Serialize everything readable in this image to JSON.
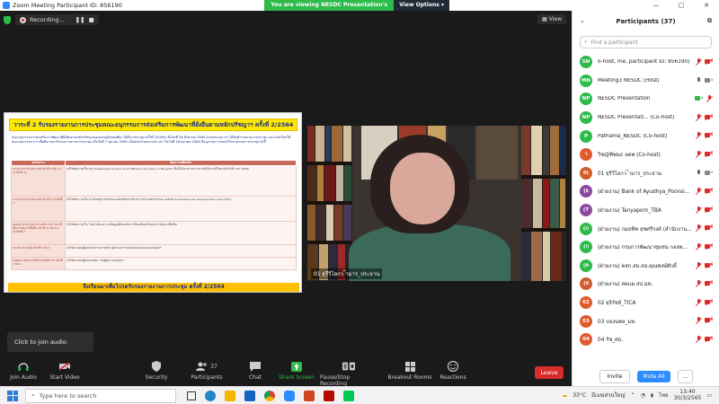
{
  "window": {
    "title": "Zoom Meeting Participant ID: 856190",
    "share_banner": "You are viewing NESDC Presentation's screen",
    "view_options": "View Options"
  },
  "meeting": {
    "recording_label": "Recording...",
    "view_label": "View",
    "video_name": "01 ฐุรีวิไลกว ๊ามาร_ประธาน"
  },
  "slide": {
    "title": "วาระที่ 2 รับรองรายงานการประชุมคณะอนุกรรมการส่งเสริมการพัฒนาที่ยั่งยืนตามหลักปรัชญาฯ ครั้งที่ 2/2564",
    "paragraph": "คณะอนุกรรมการส่งเสริมการพัฒนาที่ยั่งยืนตามหลักปรัชญาของเศรษฐกิจพอเพียง ได้มีการประชุม ครั้งที่ 2/2564 เมื่อวันที่ 26 สิงหาคม 2564 ฝ่ายเลขานุการฯ ได้จัดทำรายงานการประชุม และแจ้งเวียนให้คณะอนุกรรมการฯ เพื่อพิจารณารับรองรายงานการประชุม เมื่อวันที่ 7 ตุลาคม 2564 เมื่อครบกำหนดระยะเวลา ในวันที่ 18 ตุลาคม 2564 มีอนุกรรมการขอแก้ไขรายงานการประชุม ดังนี้",
    "col_headers": [
      "หน่วยงาน",
      "ข้อความเพิ่มเติม"
    ],
    "rows": [
      {
        "label": "กระทรวงการต่างประเทศ หน้าที่ 8 ข้อ 2.1 บรรทัดที่ 11",
        "desc": "แก้ไขข้อความเป็น 'the Sustainable Tourism and Sufficiency Economy in Mongolia' ซึ่งเป็นโครงการความร่วมมือไตรภาคีไทย มองโกเลีย และ UNDP"
      },
      {
        "label": "กระทรวงการต่างประเทศ หน้าที่ 9 บรรทัดที่ 4",
        "desc": "แก้ไขข้อความเป็น 'ครอบคลุมการดำเนินงานตามพันธกรณีระหว่างประเทศตามกรอบ ASEAN Southeast Asian Development Goal (SDG)'"
      },
      {
        "label": "ศูนย์ประสานงานความร่วมมือ ระหว่างภาคีเพื่อการพัฒนาที่ยั่งยืน หน้าที่ 11 ข้อ 2.5 บรรทัดที่ 3",
        "desc": "แก้ไขข้อความเป็น 'ในการพัฒนาระบบข้อมูลเพื่อรองรับการขับเคลื่อนเป้าหมายการพัฒนาที่ยั่งยืน'"
      },
      {
        "label": "กระทรวงการคลัง หน้าที่ 5 ข้อ 1",
        "desc": "แก้ไขคำแหน่งผู้แทนกระทรวงการคลัง 'ผู้อำนวยการกองนโยบายและแผนงานคลังฯ'"
      },
      {
        "label": "กองทุนการพัฒนาเครือข่ายทรัพยากร หน้าที่ 5 ข้อ 2",
        "desc": "แก้ไขคำแหน่งผู้แทนกองทุน 'รองผู้จัดการกองทุนฯ'"
      }
    ],
    "footer": "จึงเรียนมาเพื่อโปรดรับรองรายงานการประชุม ครั้งที่ 2/2564"
  },
  "tooltip": "Click to join audio",
  "toolbar": {
    "join_audio": "Join Audio",
    "start_video": "Start Video",
    "security": "Security",
    "participants": "Participants",
    "participants_count": "37",
    "chat": "Chat",
    "share_screen": "Share Screen",
    "pause_recording": "Pause/Stop Recording",
    "breakout_rooms": "Breakout Rooms",
    "reactions": "Reactions",
    "leave": "Leave"
  },
  "panel": {
    "title": "Participants (37)",
    "search_placeholder": "Find a participant",
    "invite": "Invite",
    "mute_all": "Mute All",
    "more": "...",
    "participants": [
      {
        "initials": "SN",
        "color": "#2dbb4a",
        "name": "o-host, me, participant ID: 856190)",
        "mic": "muted",
        "cam": "off"
      },
      {
        "initials": "MN",
        "color": "#2dbb4a",
        "name": "Meeting3 NESDC (Host)",
        "mic": "normal",
        "cam": "normal"
      },
      {
        "initials": "NP",
        "color": "#2dbb4a",
        "name": "NESDC Presentation",
        "mic": "muted",
        "cam": "on"
      },
      {
        "initials": "NP",
        "color": "#2dbb4a",
        "name": "NESDC Presentati... (Co-host)",
        "mic": "muted",
        "cam": "off"
      },
      {
        "initials": "P",
        "color": "#2dbb4a",
        "name": "Pathama_NESDC (Co-host)",
        "mic": "muted",
        "cam": "off"
      },
      {
        "initials": "ว",
        "color": "#e05a2b",
        "name": "วิชญ์ฑิพนธ ลดพ (Co-host)",
        "mic": "muted",
        "cam": "off"
      },
      {
        "initials": "0(",
        "color": "#d45b2b",
        "name": "01 ฐุรีวิไลกว ๊ามาร_ประธาน",
        "mic": "normal",
        "cam": "normal"
      },
      {
        "initials": "(ธ",
        "color": "#8b4aa0",
        "name": "(ฝ่ายงาน) Bank of Ayudhya_Poonsi...",
        "mic": "muted",
        "cam": "off"
      },
      {
        "initials": "(T",
        "color": "#8b4aa0",
        "name": "(ฝ่ายงาน) Tanyaporn_TBA",
        "mic": "muted",
        "cam": "off"
      },
      {
        "initials": "(ภ",
        "color": "#2dbb4a",
        "name": "(ฝ่ายงาน) กมลทิพ สุชศรีรงค์ (สำนักงาน...",
        "mic": "muted",
        "cam": "off"
      },
      {
        "initials": "(ก",
        "color": "#2dbb4a",
        "name": "(ฝ่ายงาน) กรมการพัฒนาชุมชน กองพ...",
        "mic": "muted",
        "cam": "off"
      },
      {
        "initials": "(ค",
        "color": "#2dbb4a",
        "name": "(ฝ่ายงาน) คสก.สบ.สอ.คุณพงษ์ศักดิ์",
        "mic": "muted",
        "cam": "off"
      },
      {
        "initials": "(ส",
        "color": "#d45b2b",
        "name": "(ฝ่ายงาน) สคแผ.สป.มท.",
        "mic": "muted",
        "cam": "off"
      },
      {
        "initials": "02",
        "color": "#e05a2b",
        "name": "02 ฐุจิร์ชย์_TICA",
        "mic": "muted",
        "cam": "off"
      },
      {
        "initials": "03",
        "color": "#e05a2b",
        "name": "03 บจงนพล_มท.",
        "mic": "muted",
        "cam": "off"
      },
      {
        "initials": "04",
        "color": "#e05a2b",
        "name": "04 รัช_ศธ.",
        "mic": "muted",
        "cam": "off"
      }
    ]
  },
  "taskbar": {
    "search_placeholder": "Type here to search",
    "temperature": "33°C",
    "weather_text": "มีเมฆส่วนใหญ่",
    "lang": "ไทย",
    "time": "13:40",
    "date": "30/3/2565"
  },
  "colors": {
    "zoom_blue": "#2d8cff",
    "share_green": "#2dbb4a",
    "leave_red": "#d92d2d",
    "slide_title_yellow": "#ffe800",
    "slide_footer_orange": "#ffc000",
    "table_header": "#c76a5a"
  }
}
